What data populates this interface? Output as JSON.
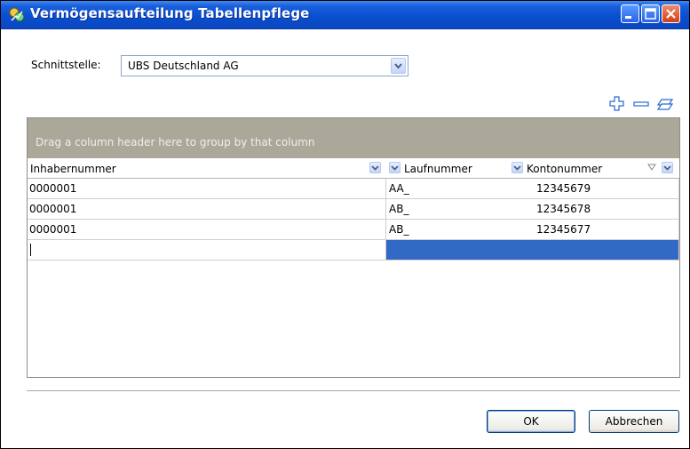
{
  "window": {
    "title": "Vermögensaufteilung Tabellenpflege",
    "controls": [
      "minimize-icon",
      "maximize-icon",
      "close-icon"
    ]
  },
  "interface": {
    "label": "Schnittstelle:",
    "selected": "UBS Deutschland AG"
  },
  "toolbar": {
    "icons": [
      "add-icon",
      "remove-icon",
      "edit-icon"
    ]
  },
  "grid": {
    "group_hint": "Drag a column header here to group by that column",
    "columns": [
      "Inhabernummer",
      "Laufnummer",
      "Kontonummer"
    ],
    "rows": [
      [
        "0000001",
        "AA_",
        "12345679"
      ],
      [
        "0000001",
        "AB_",
        "12345678"
      ],
      [
        "0000001",
        "AB_",
        "12345677"
      ]
    ],
    "new_row": [
      "",
      "",
      ""
    ]
  },
  "buttons": {
    "ok": "OK",
    "cancel": "Abbrechen"
  },
  "colors": {
    "titlebar": "#0a4fd0",
    "selection": "#316ac5",
    "group_bar": "#aca899"
  }
}
